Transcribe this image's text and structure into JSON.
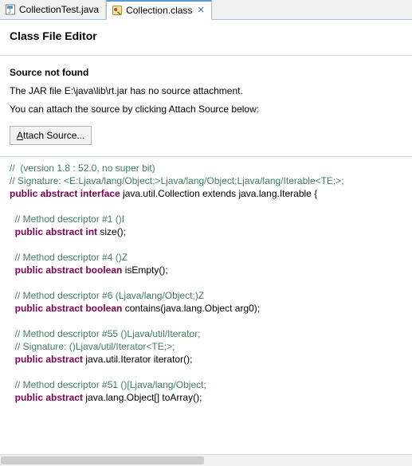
{
  "window": {
    "tabs": [
      {
        "label": "CollectionTest.java",
        "icon": "java-file-icon",
        "active": false,
        "closable": false
      },
      {
        "label": "Collection.class",
        "icon": "class-file-icon",
        "active": true,
        "closable": true,
        "close_glyph": "✕"
      }
    ]
  },
  "editor": {
    "title": "Class File Editor",
    "section_title": "Source not found",
    "paragraphs": [
      "The JAR file E:\\java\\lib\\rt.jar has no source attachment.",
      "You can attach the source by clicking Attach Source below:"
    ],
    "attach_button": {
      "mnemonic": "A",
      "rest": "ttach Source..."
    },
    "code_lines": [
      {
        "type": "comment",
        "text": "//  (version 1.8 : 52.0, no super bit)"
      },
      {
        "type": "comment",
        "text": "// Signature: <E:Ljava/lang/Object;>Ljava/lang/Object;Ljava/lang/Iterable<TE;>;"
      },
      {
        "type": "decl",
        "keyword": "public abstract interface",
        "rest": " java.util.Collection extends java.lang.Iterable {"
      },
      {
        "type": "blank",
        "text": ""
      },
      {
        "type": "comment",
        "text": "  // Method descriptor #1 ()I"
      },
      {
        "type": "decl",
        "keyword": "  public abstract int",
        "rest": " size();"
      },
      {
        "type": "blank",
        "text": ""
      },
      {
        "type": "comment",
        "text": "  // Method descriptor #4 ()Z"
      },
      {
        "type": "decl",
        "keyword": "  public abstract boolean",
        "rest": " isEmpty();"
      },
      {
        "type": "blank",
        "text": ""
      },
      {
        "type": "comment",
        "text": "  // Method descriptor #6 (Ljava/lang/Object;)Z"
      },
      {
        "type": "decl",
        "keyword": "  public abstract boolean",
        "rest": " contains(java.lang.Object arg0);"
      },
      {
        "type": "blank",
        "text": ""
      },
      {
        "type": "comment",
        "text": "  // Method descriptor #55 ()Ljava/util/Iterator;"
      },
      {
        "type": "comment",
        "text": "  // Signature: ()Ljava/util/Iterator<TE;>;"
      },
      {
        "type": "decl",
        "keyword": "  public abstract",
        "rest": " java.util.Iterator iterator();"
      },
      {
        "type": "blank",
        "text": ""
      },
      {
        "type": "comment",
        "text": "  // Method descriptor #51 ()[Ljava/lang/Object;"
      },
      {
        "type": "decl",
        "keyword": "  public abstract",
        "rest": " java.lang.Object[] toArray();"
      }
    ]
  },
  "colors": {
    "comment": "#3f7f5f",
    "keyword": "#7f0055",
    "tab_active_border": "#5b9bd5",
    "rule": "#c8d4e2"
  }
}
